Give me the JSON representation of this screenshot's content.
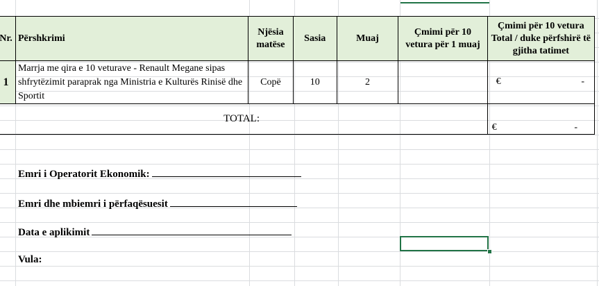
{
  "table": {
    "headers": {
      "nr": "Nr.",
      "description": "Përshkrimi",
      "unit": "Njësia matëse",
      "quantity": "Sasia",
      "months": "Muaj",
      "price_month": "Çmimi për 10 vetura për 1 muaj",
      "price_total": "Çmimi për 10 vetura Total / duke përfshirë të gjitha tatimet"
    },
    "rows": [
      {
        "nr": "1",
        "description": "Marrja me qira e 10 veturave - Renault Megane sipas shfrytëzimit paraprak nga Ministria e Kulturës Rinisë dhe Sportit",
        "unit": "Copë",
        "quantity": "10",
        "months": "2",
        "price_month": "",
        "currency": "€",
        "price_total": "-"
      }
    ],
    "total_label": "TOTAL:",
    "total_currency": "€",
    "total_value": "-"
  },
  "form": {
    "operator_label": "Emri i Operatorit Ekonomik:",
    "representative_label": "Emri dhe mbiemri i përfaqësuesit",
    "date_label": "Data e aplikimit",
    "stamp_label": "Vula:"
  },
  "colors": {
    "header_fill": "#e2efd9",
    "selection": "#217346",
    "gridline": "#dadcdf"
  }
}
